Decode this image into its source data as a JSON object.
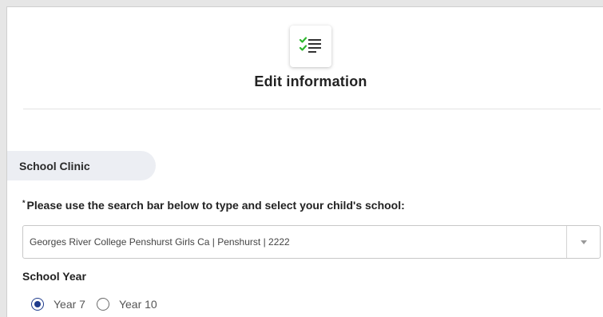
{
  "header": {
    "icon": "checklist-icon",
    "title": "Edit information"
  },
  "section": {
    "label": "School Clinic"
  },
  "school_search": {
    "required_marker": "*",
    "instruction": "Please use the search bar below to type and select your child's school:",
    "selected_value": "Georges River College Penshurst Girls Ca | Penshurst | 2222",
    "dropdown_icon": "caret-down-icon"
  },
  "school_year": {
    "label": "School Year",
    "options": [
      {
        "label": "Year 7",
        "selected": true
      },
      {
        "label": "Year 10",
        "selected": false
      }
    ]
  },
  "colors": {
    "check_green": "#2eb82e",
    "radio_selected": "#1f3c8c",
    "tab_background": "#eceef3"
  }
}
